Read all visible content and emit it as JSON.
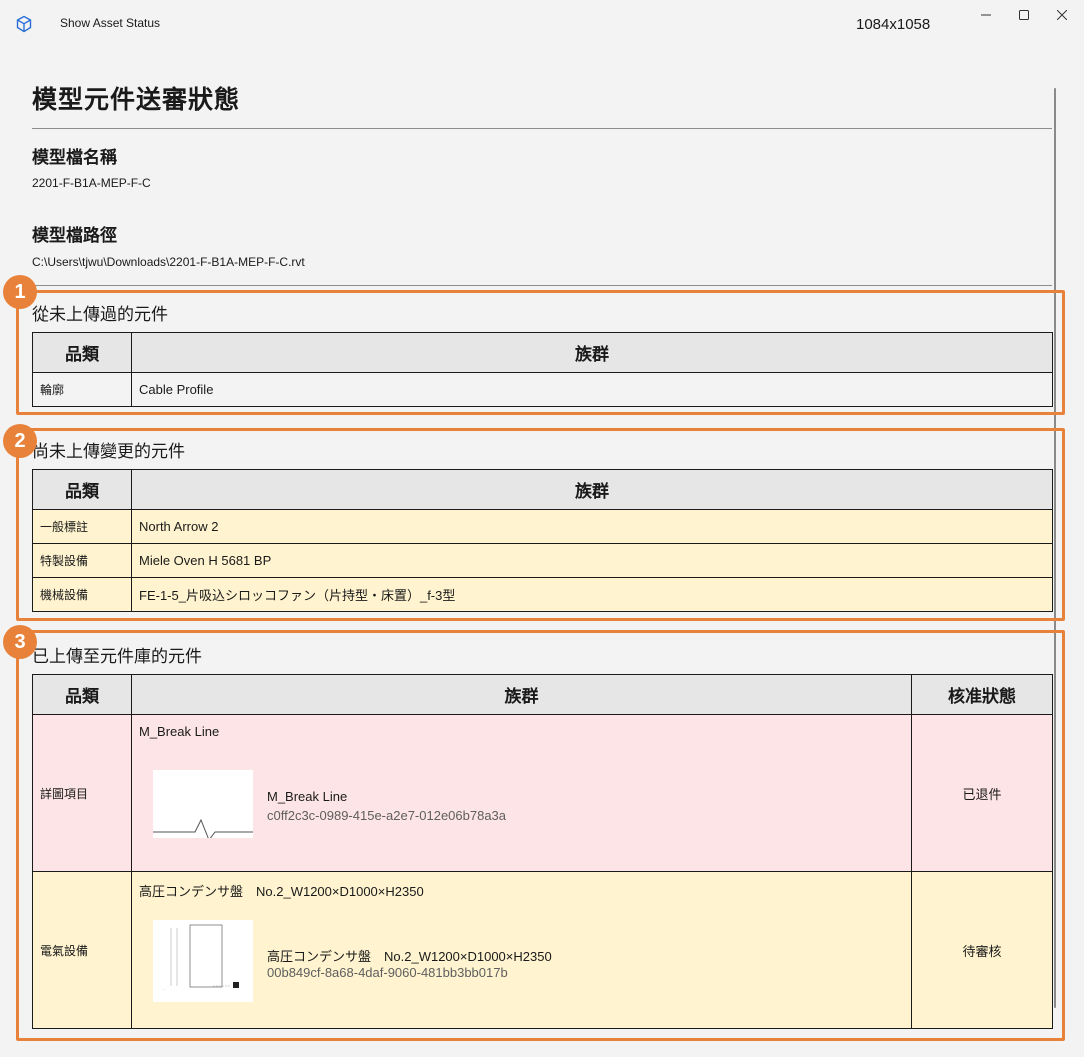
{
  "window": {
    "title": "Show Asset Status",
    "size_label": "1084x1058"
  },
  "page": {
    "title": "模型元件送審狀態",
    "model_name_heading": "模型檔名稱",
    "model_name": "2201-F-B1A-MEP-F-C",
    "model_path_heading": "模型檔路徑",
    "model_path": "C:\\Users\\tjwu\\Downloads\\2201-F-B1A-MEP-F-C.rvt"
  },
  "section_never": {
    "heading": "從未上傳過的元件",
    "callout": "1",
    "columns": [
      "品類",
      "族群"
    ],
    "rows": [
      {
        "category": "輪廓",
        "family": "Cable Profile"
      }
    ]
  },
  "section_changed": {
    "heading": "尚未上傳變更的元件",
    "callout": "2",
    "columns": [
      "品類",
      "族群"
    ],
    "rows": [
      {
        "category": "一般標註",
        "family": "North Arrow 2"
      },
      {
        "category": "特製設備",
        "family": "Miele Oven H 5681 BP"
      },
      {
        "category": "機械設備",
        "family": "FE-1-5_片吸込シロッコファン（片持型・床置）_f-3型"
      }
    ]
  },
  "section_uploaded": {
    "heading": "已上傳至元件庫的元件",
    "callout": "3",
    "columns": [
      "品類",
      "族群",
      "核准狀態"
    ],
    "rows": [
      {
        "category": "詳圖項目",
        "family": "M_Break Line",
        "asset_name": "M_Break Line",
        "asset_id": "c0ff2c3c-0989-415e-a2e7-012e06b78a3a",
        "status": "已退件"
      },
      {
        "category": "電氣設備",
        "family": "高圧コンデンサ盤　No.2_W1200×D1000×H2350",
        "asset_name": "高圧コンデンサ盤　No.2_W1200×D1000×H2350",
        "asset_id": "00b849cf-8a68-4daf-9060-481bb3bb017b",
        "status": "待審核"
      }
    ]
  },
  "colors": {
    "callout": "#e8823a",
    "row_yellow": "#fff4cf",
    "row_pink": "#fde4e6",
    "header_gray": "#e6e6e6"
  }
}
